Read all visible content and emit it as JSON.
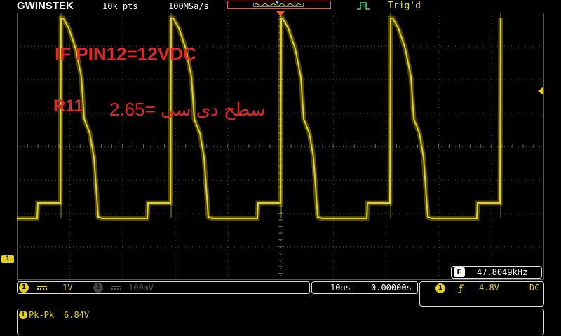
{
  "brand": "GWINSTEK",
  "header": {
    "record_length": "10k pts",
    "sample_rate": "100MSa/s",
    "trigger_status": "Trig'd"
  },
  "annotations": {
    "line1": "IF PIN12=12VDC",
    "line2": "R11",
    "line3": "سطح دی سی =2.65"
  },
  "frequency_counter": {
    "icon": "F",
    "value": "47.8049kHz"
  },
  "channel1": {
    "badge": "1",
    "scale": "1V",
    "coupling_icon": "dc-coupling-icon",
    "marker": "1"
  },
  "channel2": {
    "badge": "2",
    "scale": "100mV",
    "coupling_icon": "dc-coupling-icon"
  },
  "timebase": {
    "scale": "10us",
    "offset": "0.00000s"
  },
  "trigger": {
    "source": "1",
    "slope_icon": "rising-edge-icon",
    "level": "4.8V",
    "coupling": "DC"
  },
  "measurement": {
    "badge": "1",
    "label": "Pk-Pk",
    "value": "6.84V"
  },
  "colors": {
    "ch1": "#e6d21e",
    "annotation": "#e0282a",
    "trigger_marker": "#e65c2a",
    "background": "#000000"
  }
}
